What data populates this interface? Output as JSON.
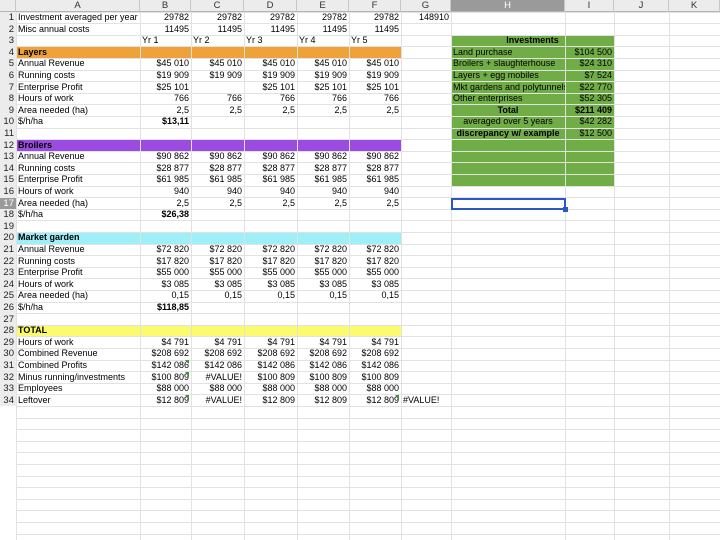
{
  "columns": [
    "A",
    "B",
    "C",
    "D",
    "E",
    "F",
    "G",
    "H",
    "I",
    "J",
    "K"
  ],
  "section_colors": {
    "layers": "#f0a23a",
    "broilers": "#9b4be0",
    "market_garden": "#9eeff8",
    "total": "#fcfa6e",
    "investments": "#71ad47",
    "selection": "#2a58c4",
    "flag": "#3b9a3b"
  },
  "rows": [
    {
      "n": "1",
      "a": "Investment averaged per year",
      "vals": [
        "29782",
        "29782",
        "29782",
        "29782",
        "29782"
      ],
      "g": "148910"
    },
    {
      "n": "2",
      "a": "Misc annual costs",
      "vals": [
        "11495",
        "11495",
        "11495",
        "11495",
        "11495"
      ],
      "g": ""
    },
    {
      "n": "3",
      "a": "",
      "vals": [
        "Yr 1",
        "Yr 2",
        "Yr 3",
        "Yr 4",
        "Yr 5"
      ],
      "g": ""
    },
    {
      "n": "4",
      "a": "Layers",
      "vals": [
        "",
        "",
        "",
        "",
        ""
      ],
      "g": ""
    },
    {
      "n": "5",
      "a": "Annual Revenue",
      "vals": [
        "$45 010",
        "$45 010",
        "$45 010",
        "$45 010",
        "$45 010"
      ],
      "g": ""
    },
    {
      "n": "6",
      "a": "Running costs",
      "vals": [
        "$19 909",
        "$19 909",
        "$19 909",
        "$19 909",
        "$19 909"
      ],
      "g": ""
    },
    {
      "n": "7",
      "a": "Enterprise Profit",
      "vals": [
        "$25 101",
        "",
        "$25 101",
        "$25 101",
        "$25 101"
      ],
      "g": ""
    },
    {
      "n": "8",
      "a": "Hours of work",
      "vals": [
        "766",
        "766",
        "766",
        "766",
        "766"
      ],
      "g": ""
    },
    {
      "n": "9",
      "a": "Area needed (ha)",
      "vals": [
        "2,5",
        "2,5",
        "2,5",
        "2,5",
        "2,5"
      ],
      "g": ""
    },
    {
      "n": "10",
      "a": "$/h/ha",
      "vals": [
        "$13,11",
        "",
        "",
        "",
        ""
      ],
      "g": ""
    },
    {
      "n": "11",
      "a": "",
      "vals": [
        "",
        "",
        "",
        "",
        ""
      ],
      "g": ""
    },
    {
      "n": "12",
      "a": "Broilers",
      "vals": [
        "",
        "",
        "",
        "",
        ""
      ],
      "g": ""
    },
    {
      "n": "13",
      "a": "Annual Revenue",
      "vals": [
        "$90 862",
        "$90 862",
        "$90 862",
        "$90 862",
        "$90 862"
      ],
      "g": ""
    },
    {
      "n": "14",
      "a": "Running costs",
      "vals": [
        "$28 877",
        "$28 877",
        "$28 877",
        "$28 877",
        "$28 877"
      ],
      "g": ""
    },
    {
      "n": "15",
      "a": "Enterprise Profit",
      "vals": [
        "$61 985",
        "$61 985",
        "$61 985",
        "$61 985",
        "$61 985"
      ],
      "g": ""
    },
    {
      "n": "16",
      "a": "Hours of work",
      "vals": [
        "940",
        "940",
        "940",
        "940",
        "940"
      ],
      "g": ""
    },
    {
      "n": "17",
      "a": "Area needed (ha)",
      "vals": [
        "2,5",
        "2,5",
        "2,5",
        "2,5",
        "2,5"
      ],
      "g": ""
    },
    {
      "n": "18",
      "a": "$/h/ha",
      "vals": [
        "$26,38",
        "",
        "",
        "",
        ""
      ],
      "g": ""
    },
    {
      "n": "19",
      "a": "",
      "vals": [
        "",
        "",
        "",
        "",
        ""
      ],
      "g": ""
    },
    {
      "n": "20",
      "a": "Market garden",
      "vals": [
        "",
        "",
        "",
        "",
        ""
      ],
      "g": ""
    },
    {
      "n": "21",
      "a": "Annual Revenue",
      "vals": [
        "$72 820",
        "$72 820",
        "$72 820",
        "$72 820",
        "$72 820"
      ],
      "g": ""
    },
    {
      "n": "22",
      "a": "Running costs",
      "vals": [
        "$17 820",
        "$17 820",
        "$17 820",
        "$17 820",
        "$17 820"
      ],
      "g": ""
    },
    {
      "n": "23",
      "a": "Enterprise Profit",
      "vals": [
        "$55 000",
        "$55 000",
        "$55 000",
        "$55 000",
        "$55 000"
      ],
      "g": ""
    },
    {
      "n": "24",
      "a": "Hours of work",
      "vals": [
        "$3 085",
        "$3 085",
        "$3 085",
        "$3 085",
        "$3 085"
      ],
      "g": ""
    },
    {
      "n": "25",
      "a": "Area needed (ha)",
      "vals": [
        "0,15",
        "0,15",
        "0,15",
        "0,15",
        "0,15"
      ],
      "g": ""
    },
    {
      "n": "26",
      "a": "$/h/ha",
      "vals": [
        "$118,85",
        "",
        "",
        "",
        ""
      ],
      "g": ""
    },
    {
      "n": "27",
      "a": "",
      "vals": [
        "",
        "",
        "",
        "",
        ""
      ],
      "g": ""
    },
    {
      "n": "28",
      "a": "TOTAL",
      "vals": [
        "",
        "",
        "",
        "",
        ""
      ],
      "g": ""
    },
    {
      "n": "29",
      "a": "Hours of work",
      "vals": [
        "$4 791",
        "$4 791",
        "$4 791",
        "$4 791",
        "$4 791"
      ],
      "g": ""
    },
    {
      "n": "30",
      "a": "Combined Revenue",
      "vals": [
        "$208 692",
        "$208 692",
        "$208 692",
        "$208 692",
        "$208 692"
      ],
      "g": ""
    },
    {
      "n": "31",
      "a": "Combined Profits",
      "vals": [
        "$142 086",
        "$142 086",
        "$142 086",
        "$142 086",
        "$142 086"
      ],
      "g": ""
    },
    {
      "n": "32",
      "a": "Minus running/investments",
      "vals": [
        "$100 809",
        "#VALUE!",
        "$100 809",
        "$100 809",
        "$100 809"
      ],
      "g": ""
    },
    {
      "n": "33",
      "a": "Employees",
      "vals": [
        "$88 000",
        "$88 000",
        "$88 000",
        "$88 000",
        "$88 000"
      ],
      "g": ""
    },
    {
      "n": "34",
      "a": "Leftover",
      "vals": [
        "$12 809",
        "#VALUE!",
        "$12 809",
        "$12 809",
        "$12 809"
      ],
      "g": "#VALUE!"
    }
  ],
  "investments": {
    "title": "Investments",
    "items": [
      {
        "label": "Land purchase",
        "value": "$104 500"
      },
      {
        "label": "Broilers + slaughterhouse",
        "value": "$24 310"
      },
      {
        "label": "Layers + egg mobiles",
        "value": "$7 524"
      },
      {
        "label": "Mkt gardens and polytunnels",
        "value": "$22 770"
      },
      {
        "label": "Other enterprises",
        "value": "$52 305"
      }
    ],
    "total_label": "Total",
    "total_value": "$211 409",
    "avg_label": "averaged over 5 years",
    "avg_value": "$42 282",
    "disc_label": "discrepancy w/ example",
    "disc_value": "$12 500"
  }
}
